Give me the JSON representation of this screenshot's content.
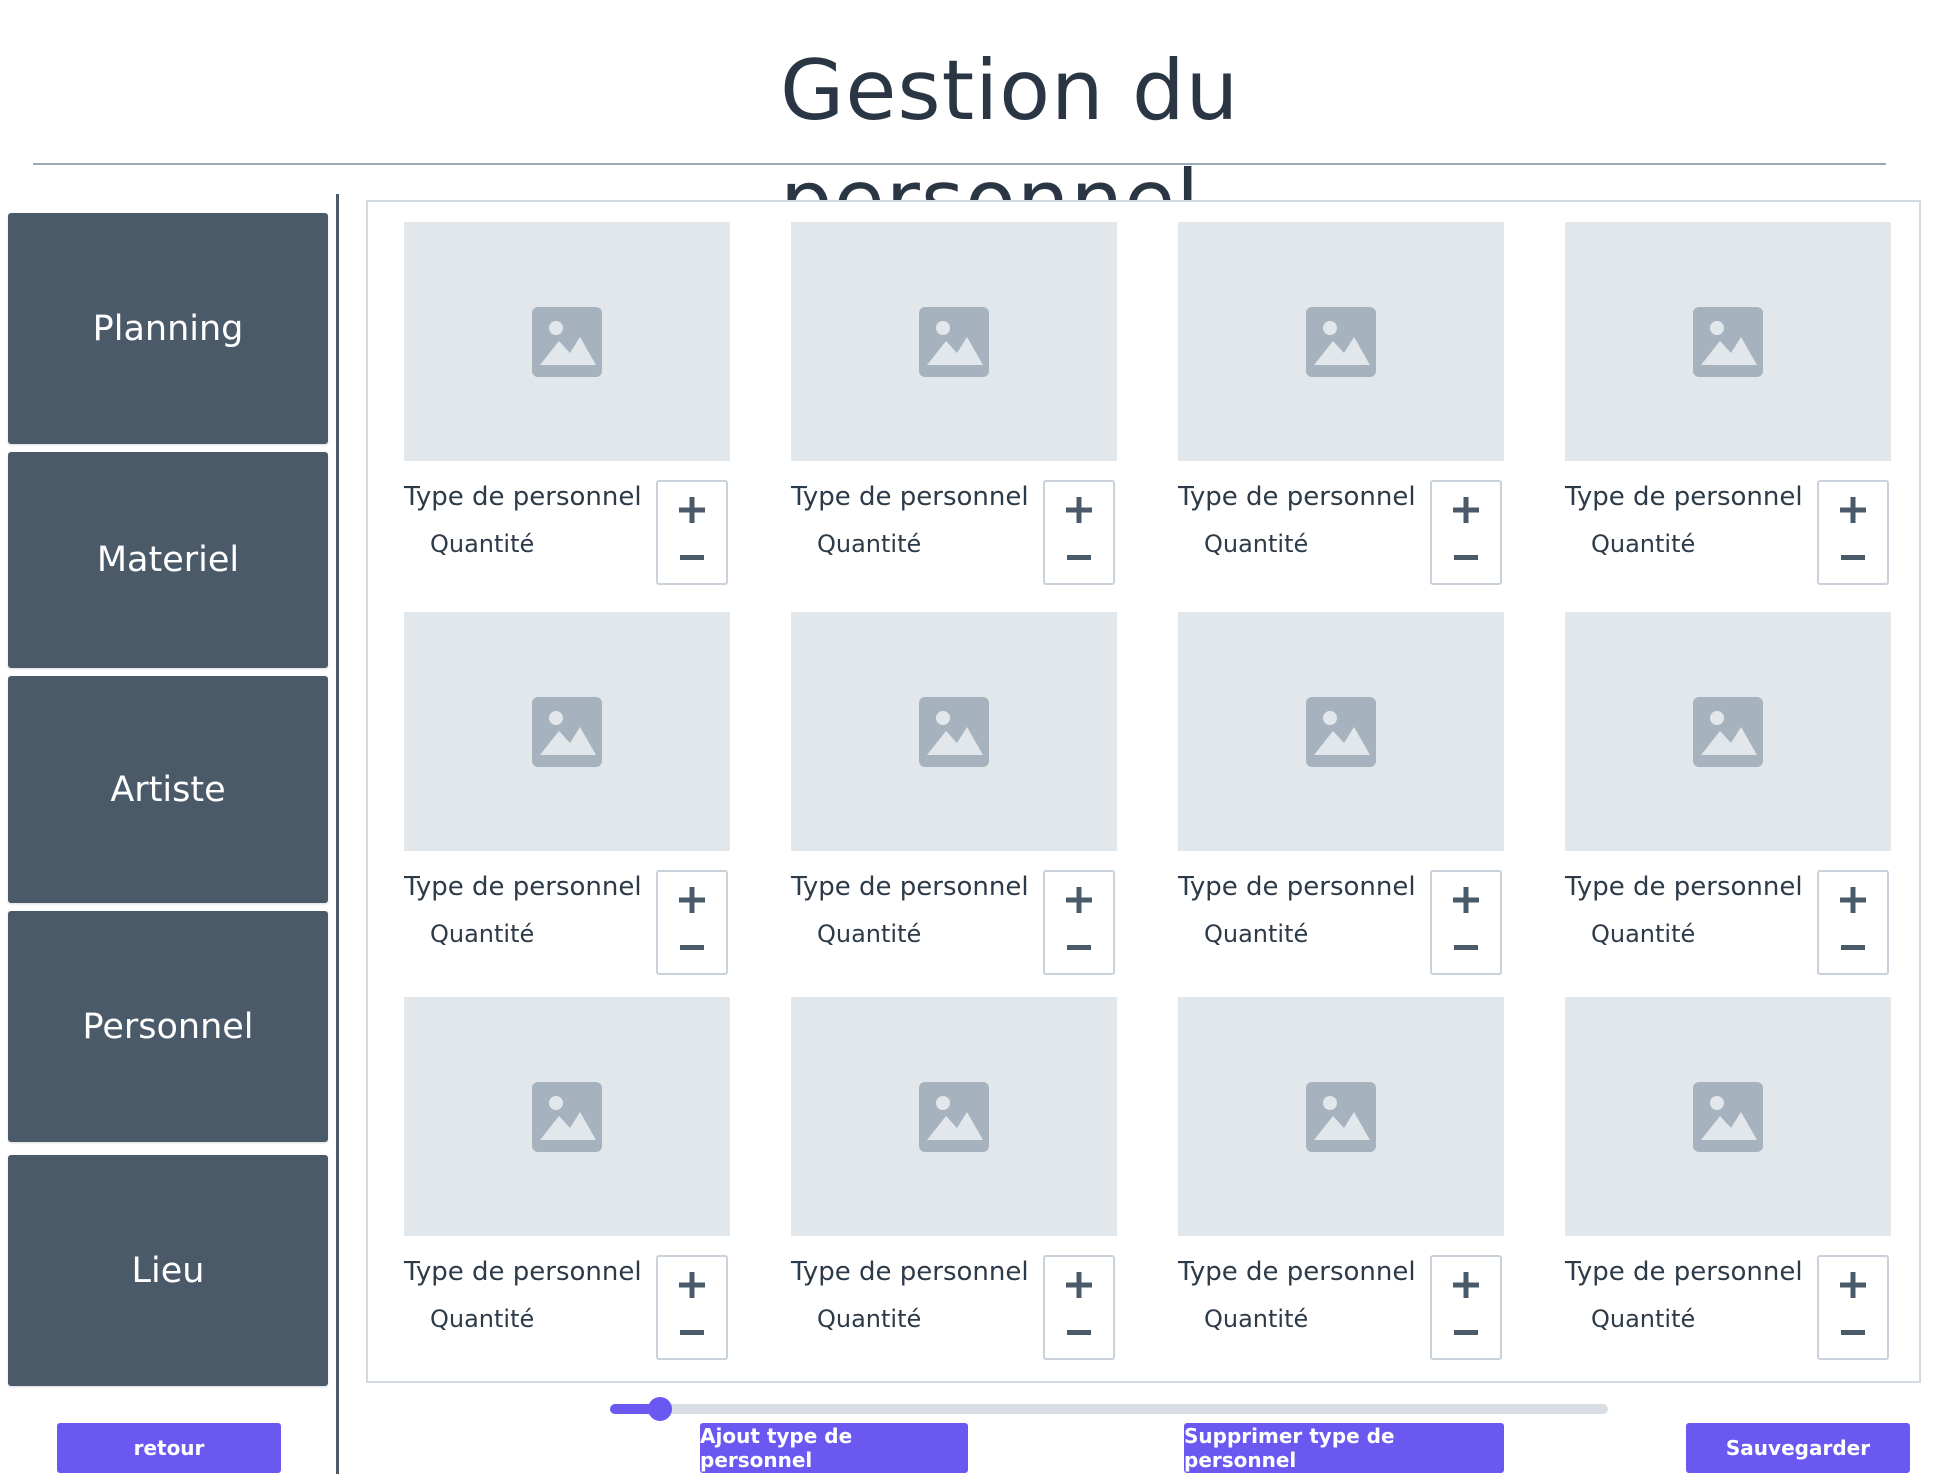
{
  "page": {
    "title": "Gestion du personnel"
  },
  "sidebar": {
    "items": [
      {
        "label": "Planning"
      },
      {
        "label": "Materiel"
      },
      {
        "label": "Artiste"
      },
      {
        "label": "Personnel"
      },
      {
        "label": "Lieu"
      }
    ],
    "back_label": "retour"
  },
  "grid": {
    "cards": [
      {
        "type_label": "Type de personnel",
        "quantity_label": "Quantité"
      },
      {
        "type_label": "Type de personnel",
        "quantity_label": "Quantité"
      },
      {
        "type_label": "Type de personnel",
        "quantity_label": "Quantité"
      },
      {
        "type_label": "Type de personnel",
        "quantity_label": "Quantité"
      },
      {
        "type_label": "Type de personnel",
        "quantity_label": "Quantité"
      },
      {
        "type_label": "Type de personnel",
        "quantity_label": "Quantité"
      },
      {
        "type_label": "Type de personnel",
        "quantity_label": "Quantité"
      },
      {
        "type_label": "Type de personnel",
        "quantity_label": "Quantité"
      },
      {
        "type_label": "Type de personnel",
        "quantity_label": "Quantité"
      },
      {
        "type_label": "Type de personnel",
        "quantity_label": "Quantité"
      },
      {
        "type_label": "Type de personnel",
        "quantity_label": "Quantité"
      },
      {
        "type_label": "Type de personnel",
        "quantity_label": "Quantité"
      }
    ]
  },
  "scroll": {
    "position_fraction": 0.05
  },
  "actions": {
    "add_label": "Ajout type de personnel",
    "delete_label": "Supprimer type de personnel",
    "save_label": "Sauvegarder"
  },
  "colors": {
    "nav_background": "#4a5a69",
    "accent": "#6b58f0",
    "placeholder_background": "#e2e7ec",
    "placeholder_icon": "#a6b3bf"
  },
  "icons": [
    "image-placeholder-icon",
    "plus-icon",
    "minus-icon"
  ]
}
